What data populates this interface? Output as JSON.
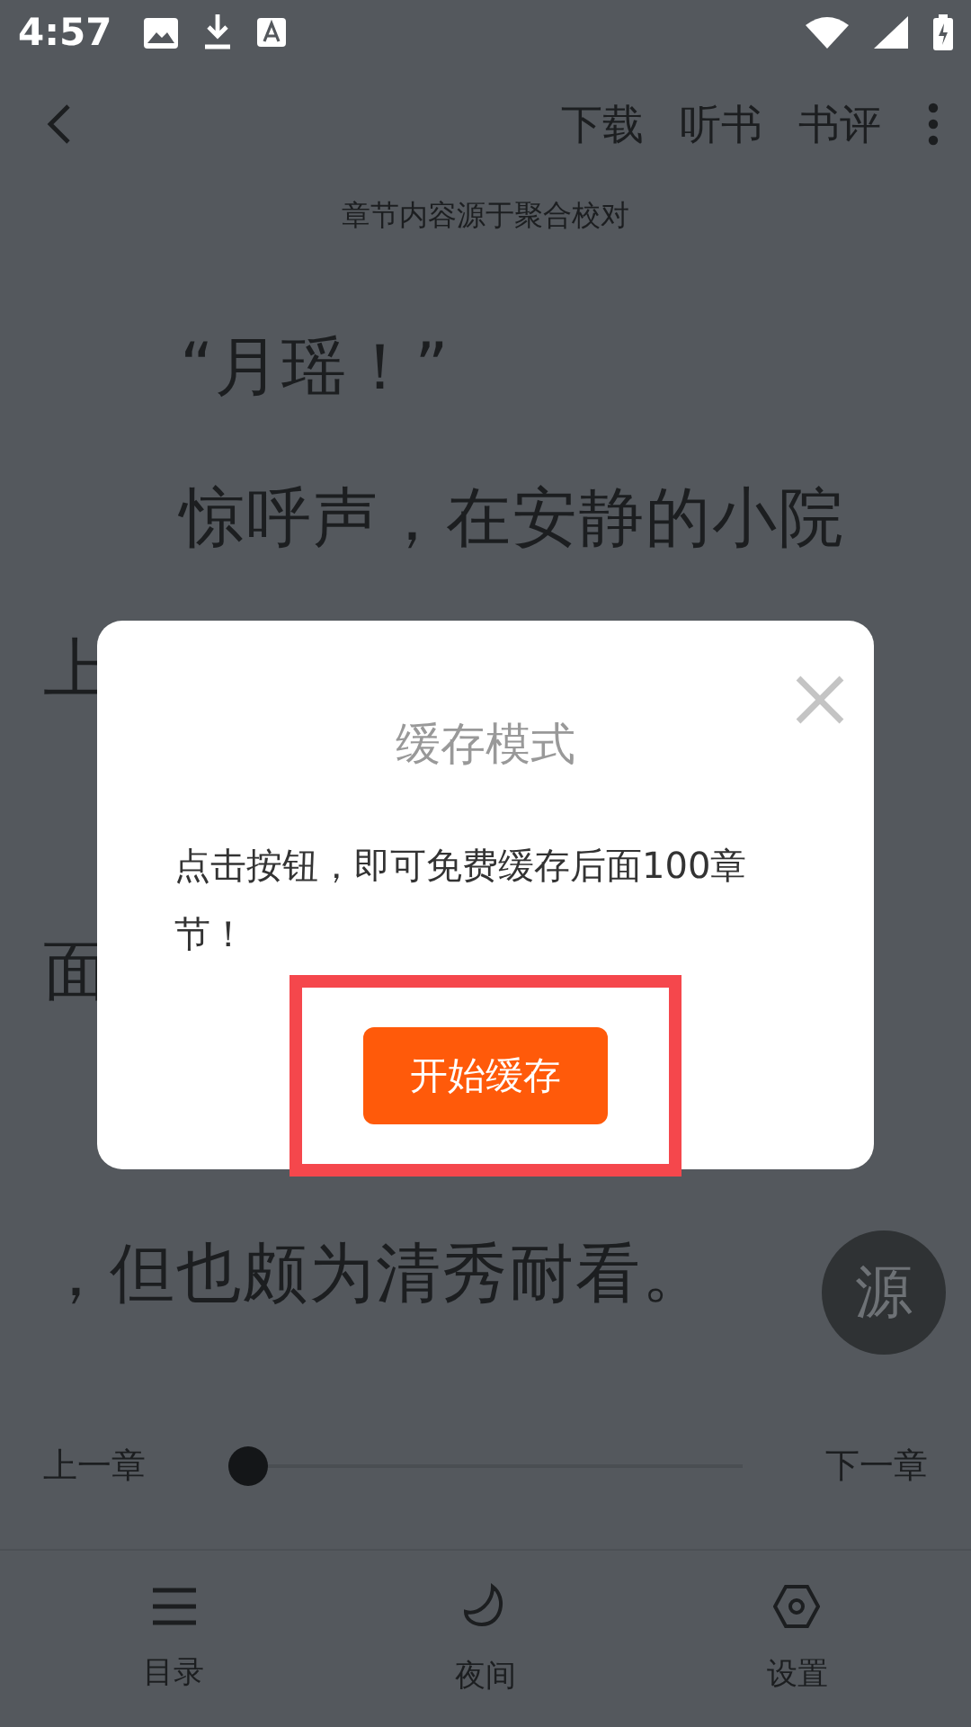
{
  "status_bar": {
    "time": "4:57"
  },
  "toolbar": {
    "actions": [
      "下载",
      "听书",
      "书评"
    ]
  },
  "source_note": "章节内容源于聚合校对",
  "content": {
    "lines": [
      {
        "kind": "indented",
        "text": "“月瑶！”"
      },
      {
        "kind": "indented",
        "text": "惊呼声，在安静的小院"
      },
      {
        "kind": "left",
        "text": "上"
      },
      {
        "kind": "covered"
      },
      {
        "kind": "left",
        "text": "面"
      },
      {
        "kind": "covered"
      },
      {
        "kind": "left",
        "text": "，但也颇为清秀耐看。"
      }
    ]
  },
  "source_button": {
    "label": "源"
  },
  "chapter_nav": {
    "previous": "上一章",
    "next": "下一章",
    "level": 0
  },
  "bottom_nav": [
    {
      "kind": "contents",
      "label": "目录"
    },
    {
      "kind": "night",
      "label": "夜间"
    },
    {
      "kind": "settings",
      "label": "设置"
    }
  ],
  "dialog": {
    "title": "缓存模式",
    "message": "点击按钮，即可免费缓存后面100章节！",
    "button": "开始缓存",
    "highlighted": true
  }
}
